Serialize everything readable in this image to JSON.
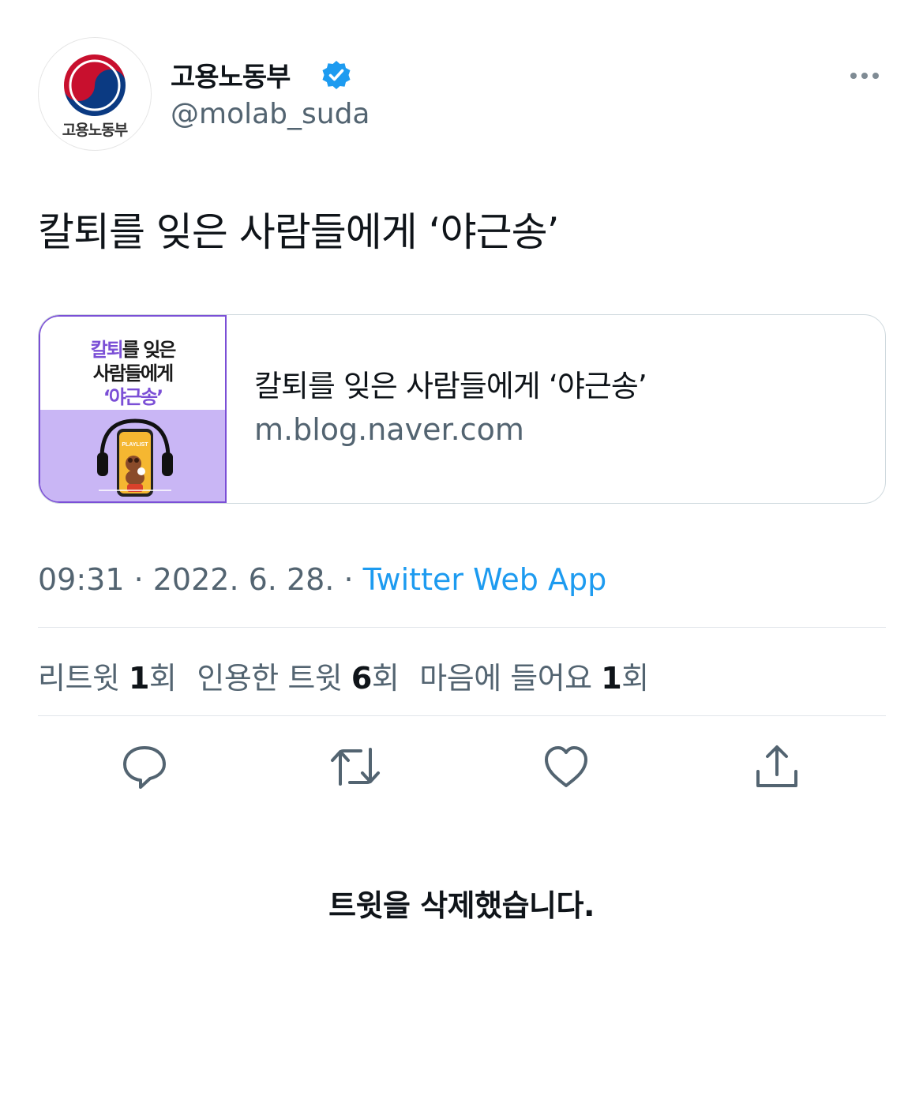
{
  "header": {
    "avatar_text": "고용노동부",
    "display_name": "고용노동부",
    "handle": "@molab_suda"
  },
  "tweet": {
    "text": "칼퇴를 잊은 사람들에게 ‘야근송’"
  },
  "card": {
    "thumb_line1_accent": "칼퇴",
    "thumb_line1_rest": "를 잊은",
    "thumb_line2": "사람들에게",
    "thumb_line3": "‘야근송’",
    "thumb_phone_label": "PLAYLIST",
    "title": "칼퇴를 잊은 사람들에게 ‘야근송’",
    "domain": "m.blog.naver.com"
  },
  "meta": {
    "timestamp": "09:31 · 2022. 6. 28. · ",
    "source": "Twitter Web App"
  },
  "stats": {
    "retweets_label": "리트윗 ",
    "retweets_count": "1",
    "retweets_unit": "회",
    "quotes_label": "인용한 트윗 ",
    "quotes_count": "6",
    "quotes_unit": "회",
    "likes_label": "마음에 들어요 ",
    "likes_count": "1",
    "likes_unit": "회"
  },
  "actions": {
    "reply_icon": "reply-icon",
    "retweet_icon": "retweet-icon",
    "like_icon": "heart-icon",
    "share_icon": "share-icon"
  },
  "footer": {
    "deleted_message": "트윗을 삭제했습니다."
  },
  "colors": {
    "link_blue": "#1d9bf0",
    "secondary_text": "#536471",
    "thumb_purple": "#7b4fd6",
    "thumb_lavender": "#c9b6f5"
  }
}
